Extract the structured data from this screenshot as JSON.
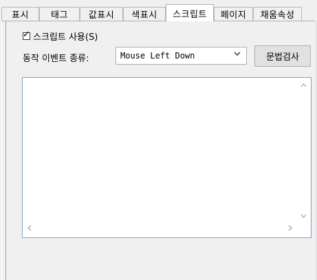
{
  "tabs": [
    {
      "label": "표시"
    },
    {
      "label": "태그"
    },
    {
      "label": "값표시"
    },
    {
      "label": "색표시"
    },
    {
      "label": "스크립트"
    },
    {
      "label": "페이지"
    },
    {
      "label": "채움속성"
    }
  ],
  "active_tab": "스크립트",
  "script": {
    "use_label": "스크립트 사용(S)",
    "use_checked": true,
    "event_type_label": "동작 이벤트 종류:",
    "event_type_value": "Mouse Left Down",
    "syntax_check_button": "문법검사",
    "editor_content": ""
  },
  "icons": {
    "checkbox": "check-mark",
    "dropdown": "chevron-down-icon",
    "scroll_up": "scroll-up-arrow",
    "scroll_down": "scroll-down-arrow",
    "scroll_left": "scroll-left-arrow",
    "scroll_right": "scroll-right-arrow"
  }
}
